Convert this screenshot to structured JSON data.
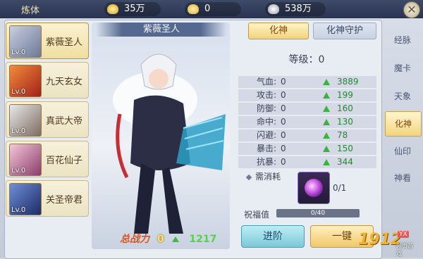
{
  "header": {
    "title": "炼体",
    "resources": [
      {
        "icon": "gold-ingot-icon",
        "value": "35万"
      },
      {
        "icon": "coin-icon",
        "value": "0"
      },
      {
        "icon": "silver-icon",
        "value": "538万"
      }
    ]
  },
  "heroes": [
    {
      "name": "紫薇圣人",
      "level": "Lv.0",
      "active": true
    },
    {
      "name": "九天玄女",
      "level": "Lv.0",
      "active": false
    },
    {
      "name": "真武大帝",
      "level": "Lv.0",
      "active": false
    },
    {
      "name": "百花仙子",
      "level": "Lv.0",
      "active": false
    },
    {
      "name": "关圣帝君",
      "level": "Lv.0",
      "active": false
    }
  ],
  "selected_hero": {
    "name": "紫薇圣人",
    "power_label": "总战力",
    "power_value": "0",
    "power_increase": "1217"
  },
  "tabs": [
    {
      "label": "化神",
      "active": true
    },
    {
      "label": "化神守护",
      "active": false
    }
  ],
  "level_text": "等级：0",
  "stats": [
    {
      "name": "气血:",
      "current": "0",
      "next": "3889"
    },
    {
      "name": "攻击:",
      "current": "0",
      "next": "199"
    },
    {
      "name": "防御:",
      "current": "0",
      "next": "160"
    },
    {
      "name": "命中:",
      "current": "0",
      "next": "130"
    },
    {
      "name": "闪避:",
      "current": "0",
      "next": "78"
    },
    {
      "name": "暴击:",
      "current": "0",
      "next": "150"
    },
    {
      "name": "抗暴:",
      "current": "0",
      "next": "344"
    }
  ],
  "cost": {
    "label": "需消耗",
    "quantity": "0/1"
  },
  "blessing": {
    "label": "祝福值",
    "text": "0/40",
    "fraction": 0
  },
  "buttons": {
    "advance": "进阶",
    "one_key": "一键"
  },
  "side_nav": [
    {
      "label": "经脉",
      "active": false
    },
    {
      "label": "魔卡",
      "active": false
    },
    {
      "label": "天象",
      "active": false
    },
    {
      "label": "化神",
      "active": true
    },
    {
      "label": "仙印",
      "active": false
    },
    {
      "label": "神看",
      "active": false
    }
  ],
  "watermark": {
    "main": "1912",
    "badge": "YX",
    "sub": "网页游戏"
  }
}
